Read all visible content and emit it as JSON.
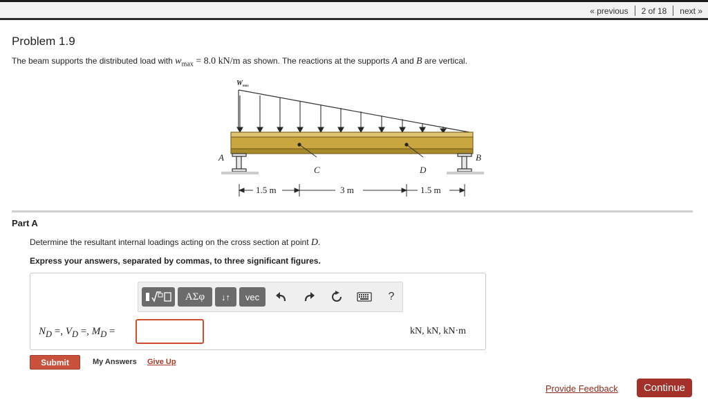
{
  "pager": {
    "previous": "« previous",
    "position": "2 of 18",
    "next": "next »"
  },
  "problem": {
    "title": "Problem 1.9",
    "statement": {
      "pre": "The beam supports the distributed load with ",
      "var": "w",
      "sub": "max",
      "value": " = 8.0 kN/m",
      "mid": " as shown. The reactions at the supports ",
      "a": "A",
      "and": " and ",
      "b": "B",
      "post": " are vertical."
    }
  },
  "figure": {
    "load_label": "W",
    "load_label_sub": "max",
    "point_a": "A",
    "point_b": "B",
    "point_c": "C",
    "point_d": "D",
    "dim1": "1.5 m",
    "dim2": "3 m",
    "dim3": "1.5 m",
    "colors": {
      "beam": "#c9a640",
      "beam_edge": "#6a5215",
      "ground": "#cccccc"
    }
  },
  "part": {
    "title": "Part A",
    "question_pre": "Determine the resultant internal loadings acting on the cross section at point ",
    "question_point": "D",
    "question_post": ".",
    "instruction": "Express your answers, separated by commas, to three significant figures."
  },
  "toolbar": {
    "templates_icon": "fraction-radical-icon",
    "greek_label": "ΑΣφ",
    "arrows_label": "↓↑",
    "vec_label": "vec",
    "undo_icon": "undo-icon",
    "redo_icon": "redo-icon",
    "reset_icon": "reset-icon",
    "keyboard_icon": "keyboard-icon",
    "help_label": "?"
  },
  "answer": {
    "label_n": "N",
    "label_v": "V",
    "label_m": "M",
    "sub": "D",
    "eq_comma": " =, ",
    "eq_end": " =",
    "value": "",
    "units": "kN, kN, kN·m"
  },
  "actions": {
    "submit": "Submit",
    "my_answers": "My Answers",
    "give_up": "Give Up",
    "feedback": "Provide Feedback",
    "continue": "Continue"
  },
  "colors": {
    "accent": "#c9503b",
    "continue": "#a4302a",
    "input_border": "#d24d2e"
  }
}
